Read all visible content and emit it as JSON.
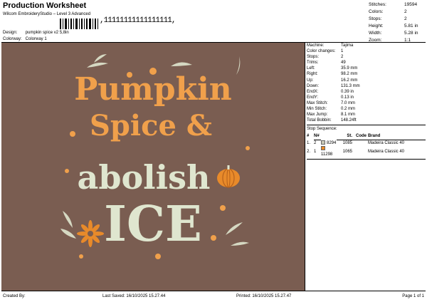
{
  "header": {
    "title": "Production Worksheet",
    "subtitle": "Wilcom EmbroideryStudio – Level 3 Advanced",
    "barcode_text": ",11111111111111111,",
    "design_label": "Design:",
    "design_value": "pumpkin spice v2 5,8in",
    "colorway_label": "Colorway:",
    "colorway_value": "Colorway 1"
  },
  "summary": [
    {
      "k": "Stitches:",
      "v": "19594"
    },
    {
      "k": "Colors:",
      "v": "2"
    },
    {
      "k": "Stops:",
      "v": "2"
    },
    {
      "k": "Height:",
      "v": "5.81 in"
    },
    {
      "k": "Width:",
      "v": "5.28 in"
    },
    {
      "k": "Zoom:",
      "v": "1:1"
    }
  ],
  "machine": [
    {
      "k": "Machine:",
      "v": "Tajima"
    },
    {
      "k": "Color changes:",
      "v": "1"
    },
    {
      "k": "Stops:",
      "v": "2"
    },
    {
      "k": "Trims:",
      "v": "49"
    },
    {
      "k": "Left:",
      "v": "35.9 mm"
    },
    {
      "k": "Right:",
      "v": "98.2 mm"
    },
    {
      "k": "Up:",
      "v": "16.2 mm"
    },
    {
      "k": "Down:",
      "v": "131.3 mm"
    },
    {
      "k": "EndX:",
      "v": "0.39 in"
    },
    {
      "k": "EndY:",
      "v": "0.13 in"
    },
    {
      "k": "Max Stitch:",
      "v": "7.0 mm"
    },
    {
      "k": "Min Stitch:",
      "v": "0.2 mm"
    },
    {
      "k": "Max Jump:",
      "v": "8.1 mm"
    },
    {
      "k": "Total Bobbin:",
      "v": "148.24ft"
    }
  ],
  "stop_sequence": {
    "label": "Stop Sequence:",
    "headers": [
      "#",
      "N#",
      "",
      "St.",
      "Code",
      "Brand"
    ],
    "rows": [
      {
        "num": "1.",
        "n": "2",
        "color": "#c9c9b8",
        "code_num": "8294",
        "st": "1085",
        "code": "",
        "brand": "Madeira Classic 40"
      },
      {
        "num": "2.",
        "n": "1",
        "color": "#e88a2a",
        "code_num": "11298",
        "st": "1065",
        "code": "",
        "brand": "Madeira Classic 40"
      }
    ]
  },
  "artwork": {
    "line1": "Pumpkin",
    "line2": "Spice &",
    "line3": "abolish",
    "line4": "ICE",
    "bg": "#7a5d51",
    "orange": "#f0a04b",
    "cream": "#dfe6cf"
  },
  "footer": {
    "created_by": "Created By:",
    "last_saved": "Last Saved: 16/10/2025 15.27.44",
    "printed": "Printed: 16/10/2025 15.27.47",
    "page": "Page 1 of 1"
  }
}
